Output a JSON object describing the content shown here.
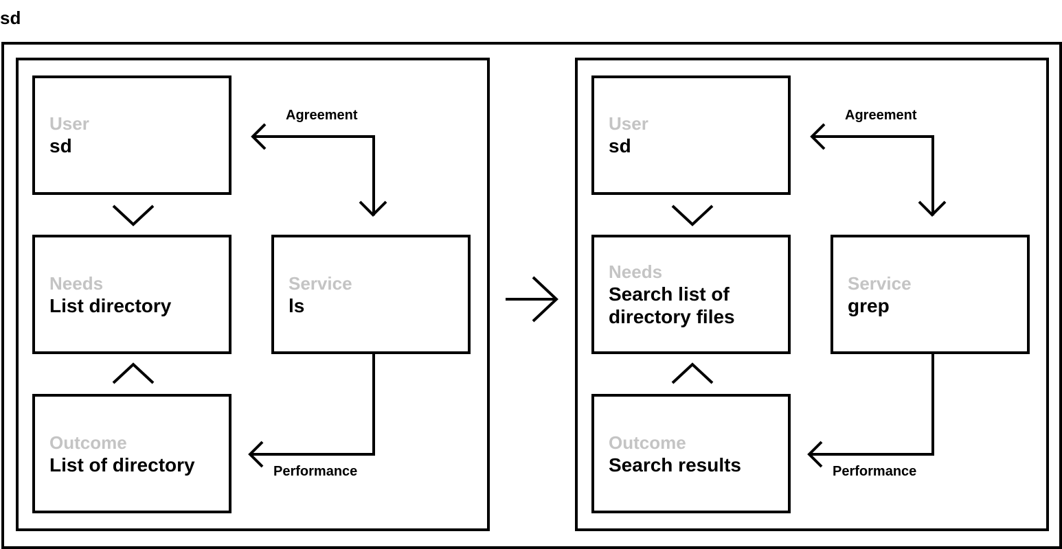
{
  "title": "sd",
  "panels": [
    {
      "user": {
        "label": "User",
        "value": "sd"
      },
      "needs": {
        "label": "Needs",
        "value": "List directory"
      },
      "service": {
        "label": "Service",
        "value": "ls"
      },
      "outcome": {
        "label": "Outcome",
        "value": "List of directory"
      },
      "agreement_label": "Agreement",
      "performance_label": "Performance"
    },
    {
      "user": {
        "label": "User",
        "value": "sd"
      },
      "needs": {
        "label": "Needs",
        "value": "Search list of directory files"
      },
      "service": {
        "label": "Service",
        "value": "grep"
      },
      "outcome": {
        "label": "Outcome",
        "value": "Search results"
      },
      "agreement_label": "Agreement",
      "performance_label": "Performance"
    }
  ],
  "colors": {
    "stroke": "#000000",
    "muted_label": "#c4c4c4",
    "background": "#ffffff"
  }
}
